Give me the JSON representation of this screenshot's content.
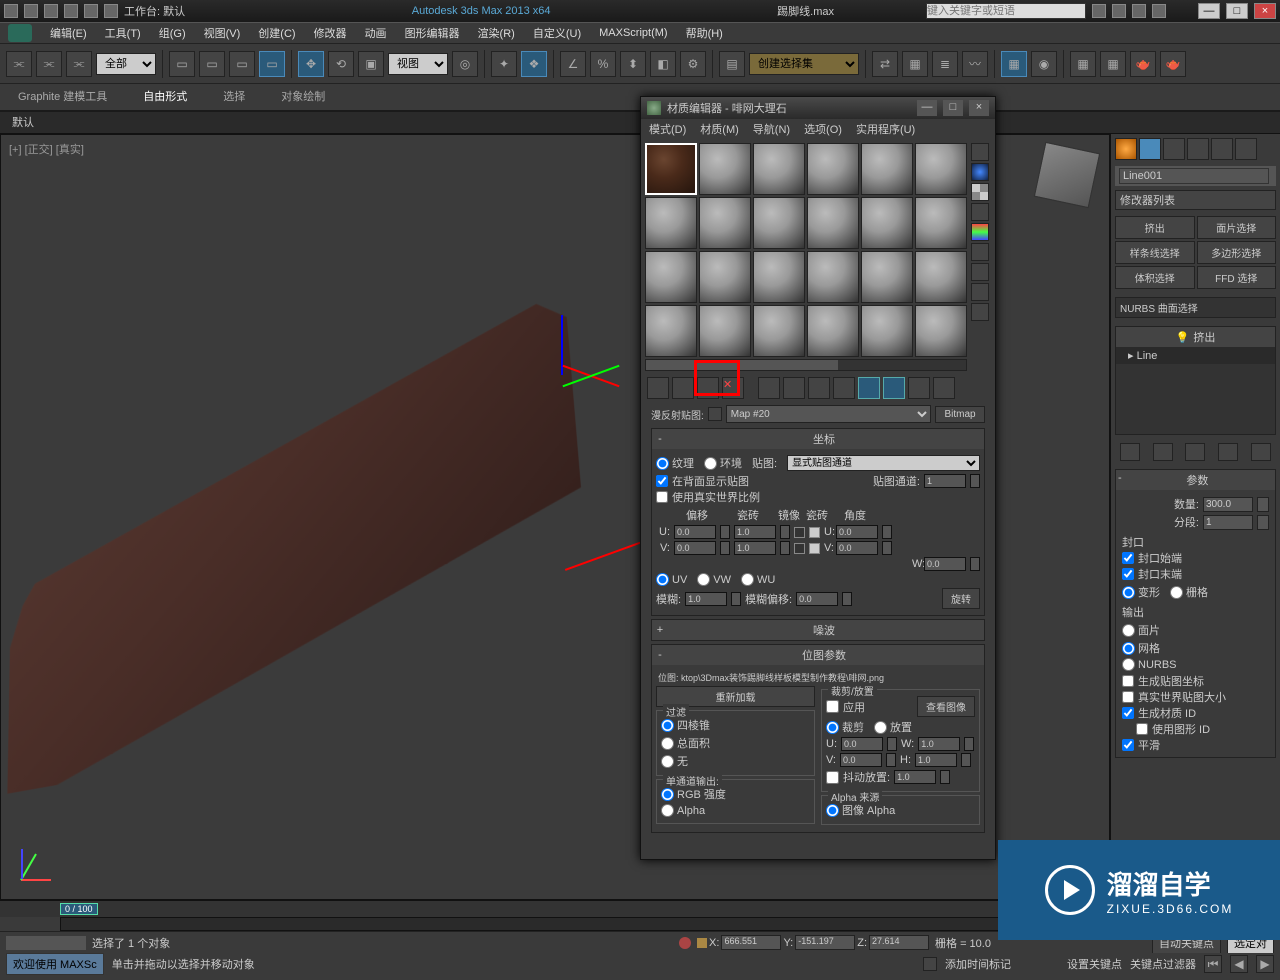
{
  "title": {
    "app": "Autodesk 3ds Max  2013 x64",
    "file": "踢脚线.max",
    "workspace_label": "工作台: 默认",
    "search_placeholder": "键入关键字或短语"
  },
  "menu": [
    "编辑(E)",
    "工具(T)",
    "组(G)",
    "视图(V)",
    "创建(C)",
    "修改器",
    "动画",
    "图形编辑器",
    "渲染(R)",
    "自定义(U)",
    "MAXScript(M)",
    "帮助(H)"
  ],
  "toolbar": {
    "all": "全部",
    "view": "视图",
    "selset_ph": "创建选择集"
  },
  "ribbon": {
    "tabs": [
      "Graphite 建模工具",
      "自由形式",
      "选择",
      "对象绘制"
    ],
    "sub": "默认"
  },
  "viewport": {
    "label": "[+] [正交] [真实]"
  },
  "cmdpanel": {
    "objname": "Line001",
    "modlist_label": "修改器列表",
    "btns": [
      "挤出",
      "面片选择",
      "样条线选择",
      "多边形选择",
      "体积选择",
      "FFD 选择"
    ],
    "nurbs": "NURBS 曲面选择",
    "stack": {
      "hdr": "挤出",
      "item": "Line"
    },
    "params_title": "参数",
    "amount_label": "数量:",
    "amount": "300.0",
    "seg_label": "分段:",
    "seg": "1",
    "cap_title": "封口",
    "cap_start": "封口始端",
    "cap_end": "封口末端",
    "morph": "变形",
    "grid": "栅格",
    "output_title": "输出",
    "patch": "面片",
    "mesh": "网格",
    "nurbs_out": "NURBS",
    "gen_map": "生成贴图坐标",
    "real_world": "真实世界贴图大小",
    "gen_mat": "生成材质 ID",
    "use_shape": "使用图形 ID",
    "smooth": "平滑"
  },
  "timeline": {
    "frame": "0 / 100",
    "sel": "选择了 1 个对象",
    "x": "666.551",
    "y": "-151.197",
    "z": "27.614",
    "grid": "栅格 = 10.0",
    "autokey": "自动关键点",
    "selected_only": "选定对",
    "setkey": "设置关键点",
    "keyfilter": "关键点过滤器",
    "addmarker": "添加时间标记",
    "welcome": "欢迎使用 MAXSc",
    "hint": "单击并拖动以选择并移动对象"
  },
  "mateditor": {
    "title": "材质编辑器 - 啡网大理石",
    "menu": [
      "模式(D)",
      "材质(M)",
      "导航(N)",
      "选项(O)",
      "实用程序(U)"
    ],
    "slot_label": "漫反射贴图:",
    "map_name": "Map #20",
    "type_btn": "Bitmap",
    "coord_title": "坐标",
    "texture": "纹理",
    "env": "环境",
    "mapping_label": "贴图:",
    "mapping": "显式贴图通道",
    "show_back": "在背面显示贴图",
    "map_channel_label": "贴图通道:",
    "map_channel": "1",
    "real_world_scale": "使用真实世界比例",
    "offset": "偏移",
    "tiling": "瓷砖",
    "mirror": "镜像",
    "tile": "瓷砖",
    "angle": "角度",
    "u": "U:",
    "v": "V:",
    "w": "W:",
    "u_off": "0.0",
    "u_til": "1.0",
    "u_ang": "0.0",
    "v_off": "0.0",
    "v_til": "1.0",
    "v_ang": "0.0",
    "w_ang": "0.0",
    "uv": "UV",
    "vw": "VW",
    "wu": "WU",
    "blur_label": "模糊:",
    "blur": "1.0",
    "blur_off_label": "模糊偏移:",
    "blur_off": "0.0",
    "rotate": "旋转",
    "noise_title": "噪波",
    "bitmap_title": "位图参数",
    "bitmap_path": "位图: ktop\\3Dmax装饰踢脚线样板模型制作教程\\啡网.png",
    "reload": "重新加载",
    "crop_title": "裁剪/放置",
    "apply": "应用",
    "view_image": "查看图像",
    "crop": "裁剪",
    "place": "放置",
    "cu": "0.0",
    "cw": "1.0",
    "cv": "0.0",
    "ch": "1.0",
    "jitter": "抖动放置:",
    "jitter_v": "1.0",
    "filter_title": "过滤",
    "pyramid": "四棱锥",
    "summed": "总面积",
    "none": "无",
    "mono_title": "单通道输出:",
    "rgb_int": "RGB 强度",
    "alpha_out": "Alpha",
    "alpha_src": "Alpha 来源",
    "img_alpha": "图像 Alpha"
  },
  "watermark": {
    "big": "溜溜自学",
    "small": "ZIXUE.3D66.COM"
  }
}
